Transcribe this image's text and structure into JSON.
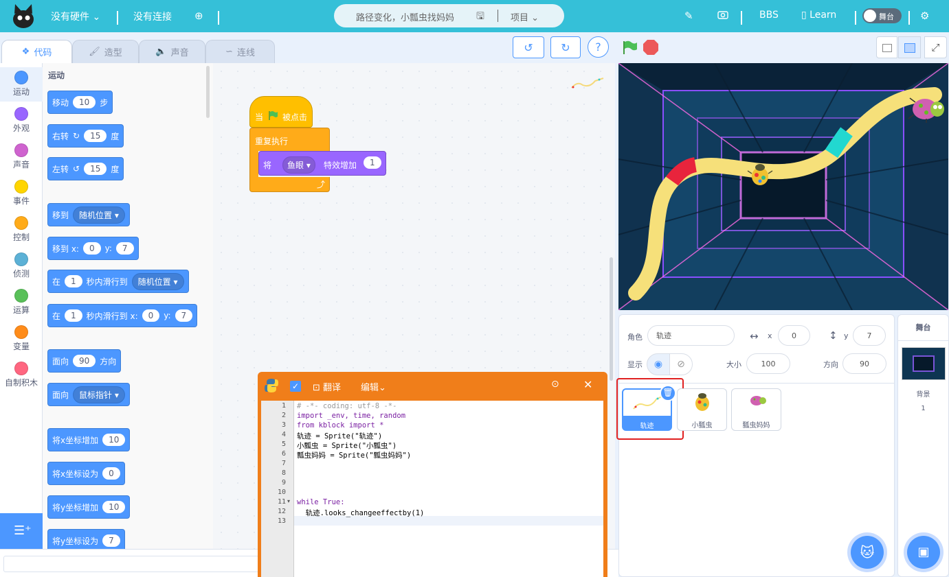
{
  "topbar": {
    "hardware": "没有硬件",
    "connection": "没有连接",
    "project_title": "路径变化，小瓢虫找妈妈",
    "project_menu": "项目",
    "bbs": "BBS",
    "learn": "Learn",
    "stage_toggle": "舞台"
  },
  "tabs": [
    "代码",
    "造型",
    "声音",
    "连线"
  ],
  "categories": [
    {
      "label": "运动",
      "color": "#4c97ff"
    },
    {
      "label": "外观",
      "color": "#9966ff"
    },
    {
      "label": "声音",
      "color": "#cf63cf"
    },
    {
      "label": "事件",
      "color": "#ffd500"
    },
    {
      "label": "控制",
      "color": "#ffab19"
    },
    {
      "label": "侦测",
      "color": "#5cb1d6"
    },
    {
      "label": "运算",
      "color": "#59c059"
    },
    {
      "label": "变量",
      "color": "#ff8c1a"
    },
    {
      "label": "自制积木",
      "color": "#ff6680"
    }
  ],
  "palette": {
    "heading": "运动",
    "move": {
      "a": "移动",
      "v": "10",
      "b": "步"
    },
    "turn_right": {
      "a": "右转",
      "v": "15",
      "b": "度"
    },
    "turn_left": {
      "a": "左转",
      "v": "15",
      "b": "度"
    },
    "goto": {
      "a": "移到",
      "d": "随机位置"
    },
    "goto_xy": {
      "a": "移到 x:",
      "x": "0",
      "yl": "y:",
      "y": "7"
    },
    "glide": {
      "a": "在",
      "v": "1",
      "b": "秒内滑行到",
      "d": "随机位置"
    },
    "glide_xy": {
      "a": "在",
      "v": "1",
      "b": "秒内滑行到 x:",
      "x": "0",
      "yl": "y:",
      "y": "7"
    },
    "point_dir": {
      "a": "面向",
      "v": "90",
      "b": "方向"
    },
    "point_to": {
      "a": "面向",
      "d": "鼠标指针"
    },
    "change_x": {
      "a": "将x坐标增加",
      "v": "10"
    },
    "set_x": {
      "a": "将x坐标设为",
      "v": "0"
    },
    "change_y": {
      "a": "将y坐标增加",
      "v": "10"
    },
    "set_y": {
      "a": "将y坐标设为",
      "v": "7"
    }
  },
  "script": {
    "hat_a": "当",
    "hat_b": "被点击",
    "forever": "重复执行",
    "effect_a": "将",
    "effect_d": "鱼眼",
    "effect_b": "特效增加",
    "effect_v": "1"
  },
  "code_window": {
    "translate": "翻译",
    "edit": "编辑",
    "lines": [
      {
        "n": "1",
        "t": "# -*- coding: utf-8 -*-",
        "k": "cm"
      },
      {
        "n": "2",
        "t": "import _env, time, random",
        "k": "kw"
      },
      {
        "n": "3",
        "t": "from kblock import *",
        "k": "kw"
      },
      {
        "n": "4",
        "t": "轨迹 = Sprite(\"轨迹\")",
        "k": ""
      },
      {
        "n": "5",
        "t": "小瓢虫 = Sprite(\"小瓢虫\")",
        "k": ""
      },
      {
        "n": "6",
        "t": "瓢虫妈妈 = Sprite(\"瓢虫妈妈\")",
        "k": ""
      },
      {
        "n": "7",
        "t": "",
        "k": ""
      },
      {
        "n": "8",
        "t": "",
        "k": ""
      },
      {
        "n": "9",
        "t": "",
        "k": ""
      },
      {
        "n": "10",
        "t": "",
        "k": ""
      },
      {
        "n": "11",
        "t": "while True:",
        "k": "kw"
      },
      {
        "n": "12",
        "t": "  轨迹.looks_changeeffectby(1)",
        "k": ""
      },
      {
        "n": "13",
        "t": "",
        "k": ""
      }
    ]
  },
  "sprite_info": {
    "sprite_label": "角色",
    "sprite_name": "轨迹",
    "x_label": "x",
    "x": "0",
    "y_label": "y",
    "y": "7",
    "show_label": "显示",
    "size_label": "大小",
    "size": "100",
    "direction_label": "方向",
    "direction": "90"
  },
  "sprites": [
    "轨迹",
    "小瓢虫",
    "瓢虫妈妈"
  ],
  "stage_panel": {
    "title": "舞台",
    "backdrop_label": "背景",
    "backdrop_count": "1"
  }
}
